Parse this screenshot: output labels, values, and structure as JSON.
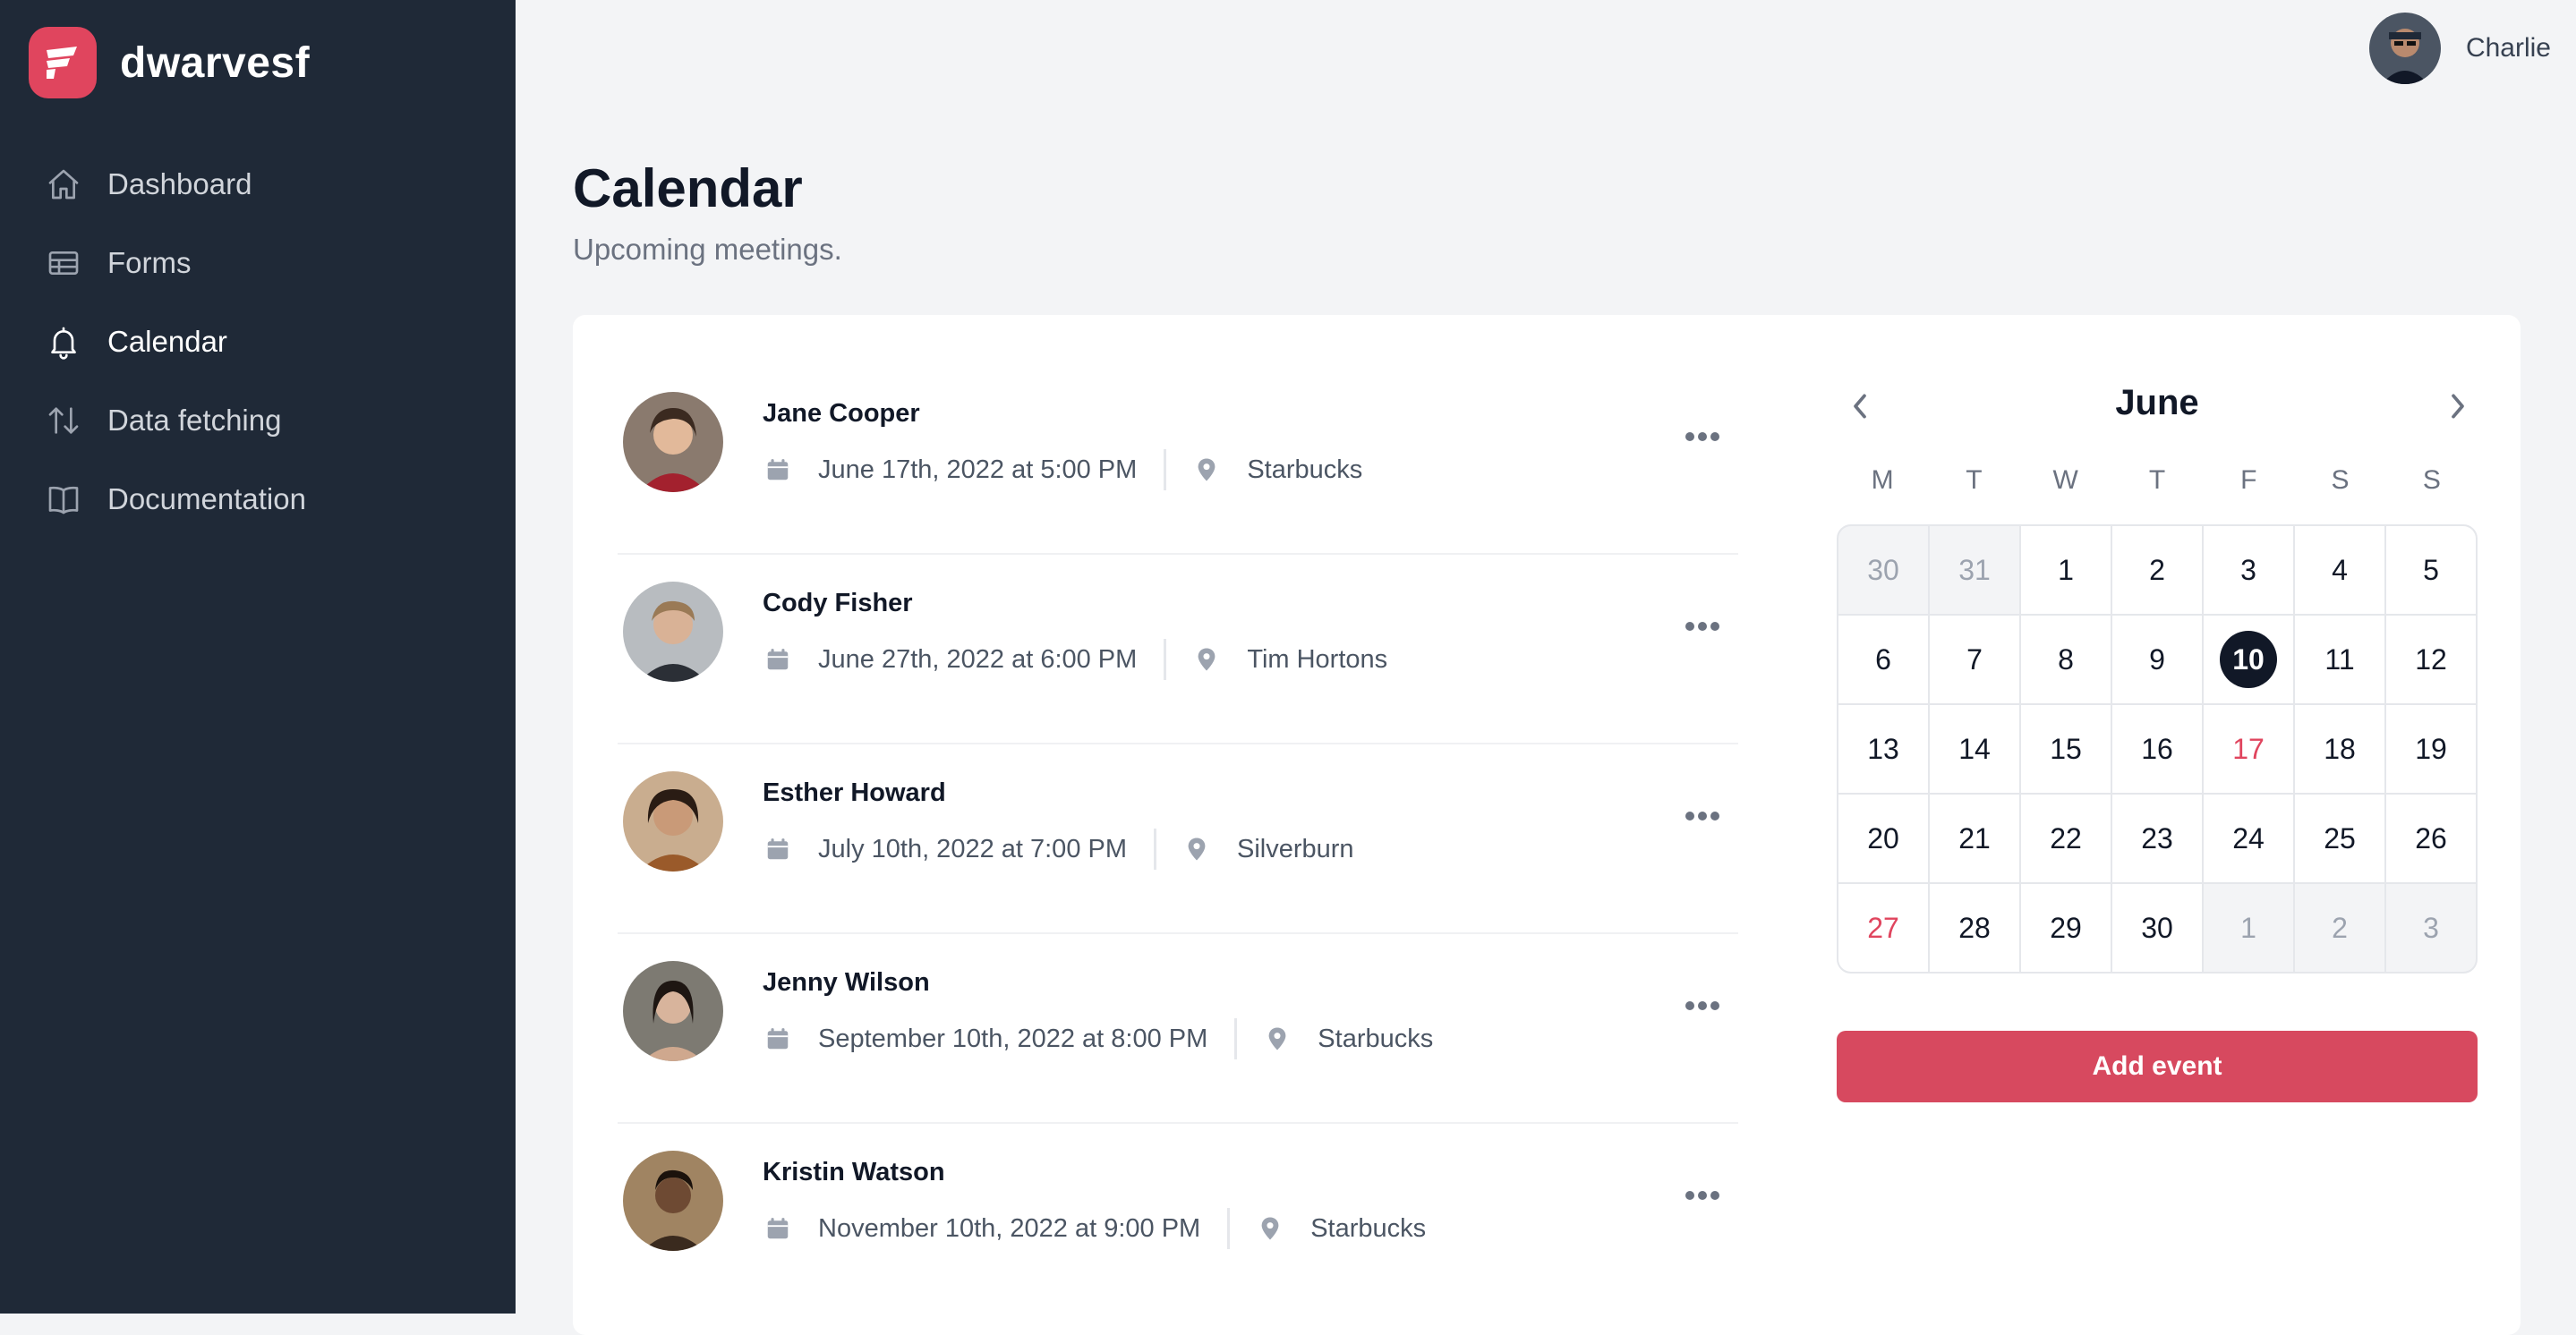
{
  "brand": {
    "name": "dwarvesf"
  },
  "sidebar": {
    "items": [
      {
        "label": "Dashboard",
        "icon": "home-icon"
      },
      {
        "label": "Forms",
        "icon": "table-icon"
      },
      {
        "label": "Calendar",
        "icon": "bell-icon",
        "active": true
      },
      {
        "label": "Data fetching",
        "icon": "arrows-up-down-icon"
      },
      {
        "label": "Documentation",
        "icon": "book-icon"
      }
    ]
  },
  "user": {
    "name": "Charlie"
  },
  "page": {
    "title": "Calendar",
    "subtitle": "Upcoming meetings."
  },
  "meetings": [
    {
      "name": "Jane Cooper",
      "date": "June 17th, 2022 at 5:00 PM",
      "location": "Starbucks"
    },
    {
      "name": "Cody Fisher",
      "date": "June 27th, 2022 at 6:00 PM",
      "location": "Tim Hortons"
    },
    {
      "name": "Esther Howard",
      "date": "July 10th, 2022 at 7:00 PM",
      "location": "Silverburn"
    },
    {
      "name": "Jenny Wilson",
      "date": "September 10th, 2022 at 8:00 PM",
      "location": "Starbucks"
    },
    {
      "name": "Kristin Watson",
      "date": "November 10th, 2022 at 9:00 PM",
      "location": "Starbucks"
    }
  ],
  "calendar": {
    "month": "June",
    "weekdays": [
      "M",
      "T",
      "W",
      "T",
      "F",
      "S",
      "S"
    ],
    "days": [
      "30",
      "31",
      "1",
      "2",
      "3",
      "4",
      "5",
      "6",
      "7",
      "8",
      "9",
      "10",
      "11",
      "12",
      "13",
      "14",
      "15",
      "16",
      "17",
      "18",
      "19",
      "20",
      "21",
      "22",
      "23",
      "24",
      "25",
      "26",
      "27",
      "28",
      "29",
      "30",
      "1",
      "2",
      "3"
    ],
    "selected_day": "10",
    "highlighted_days": [
      "17",
      "27"
    ],
    "add_event_label": "Add event",
    "highlight_color": "#e0455e"
  },
  "colors": {
    "sidebar": "#1f2937",
    "accent": "#d7495f"
  }
}
